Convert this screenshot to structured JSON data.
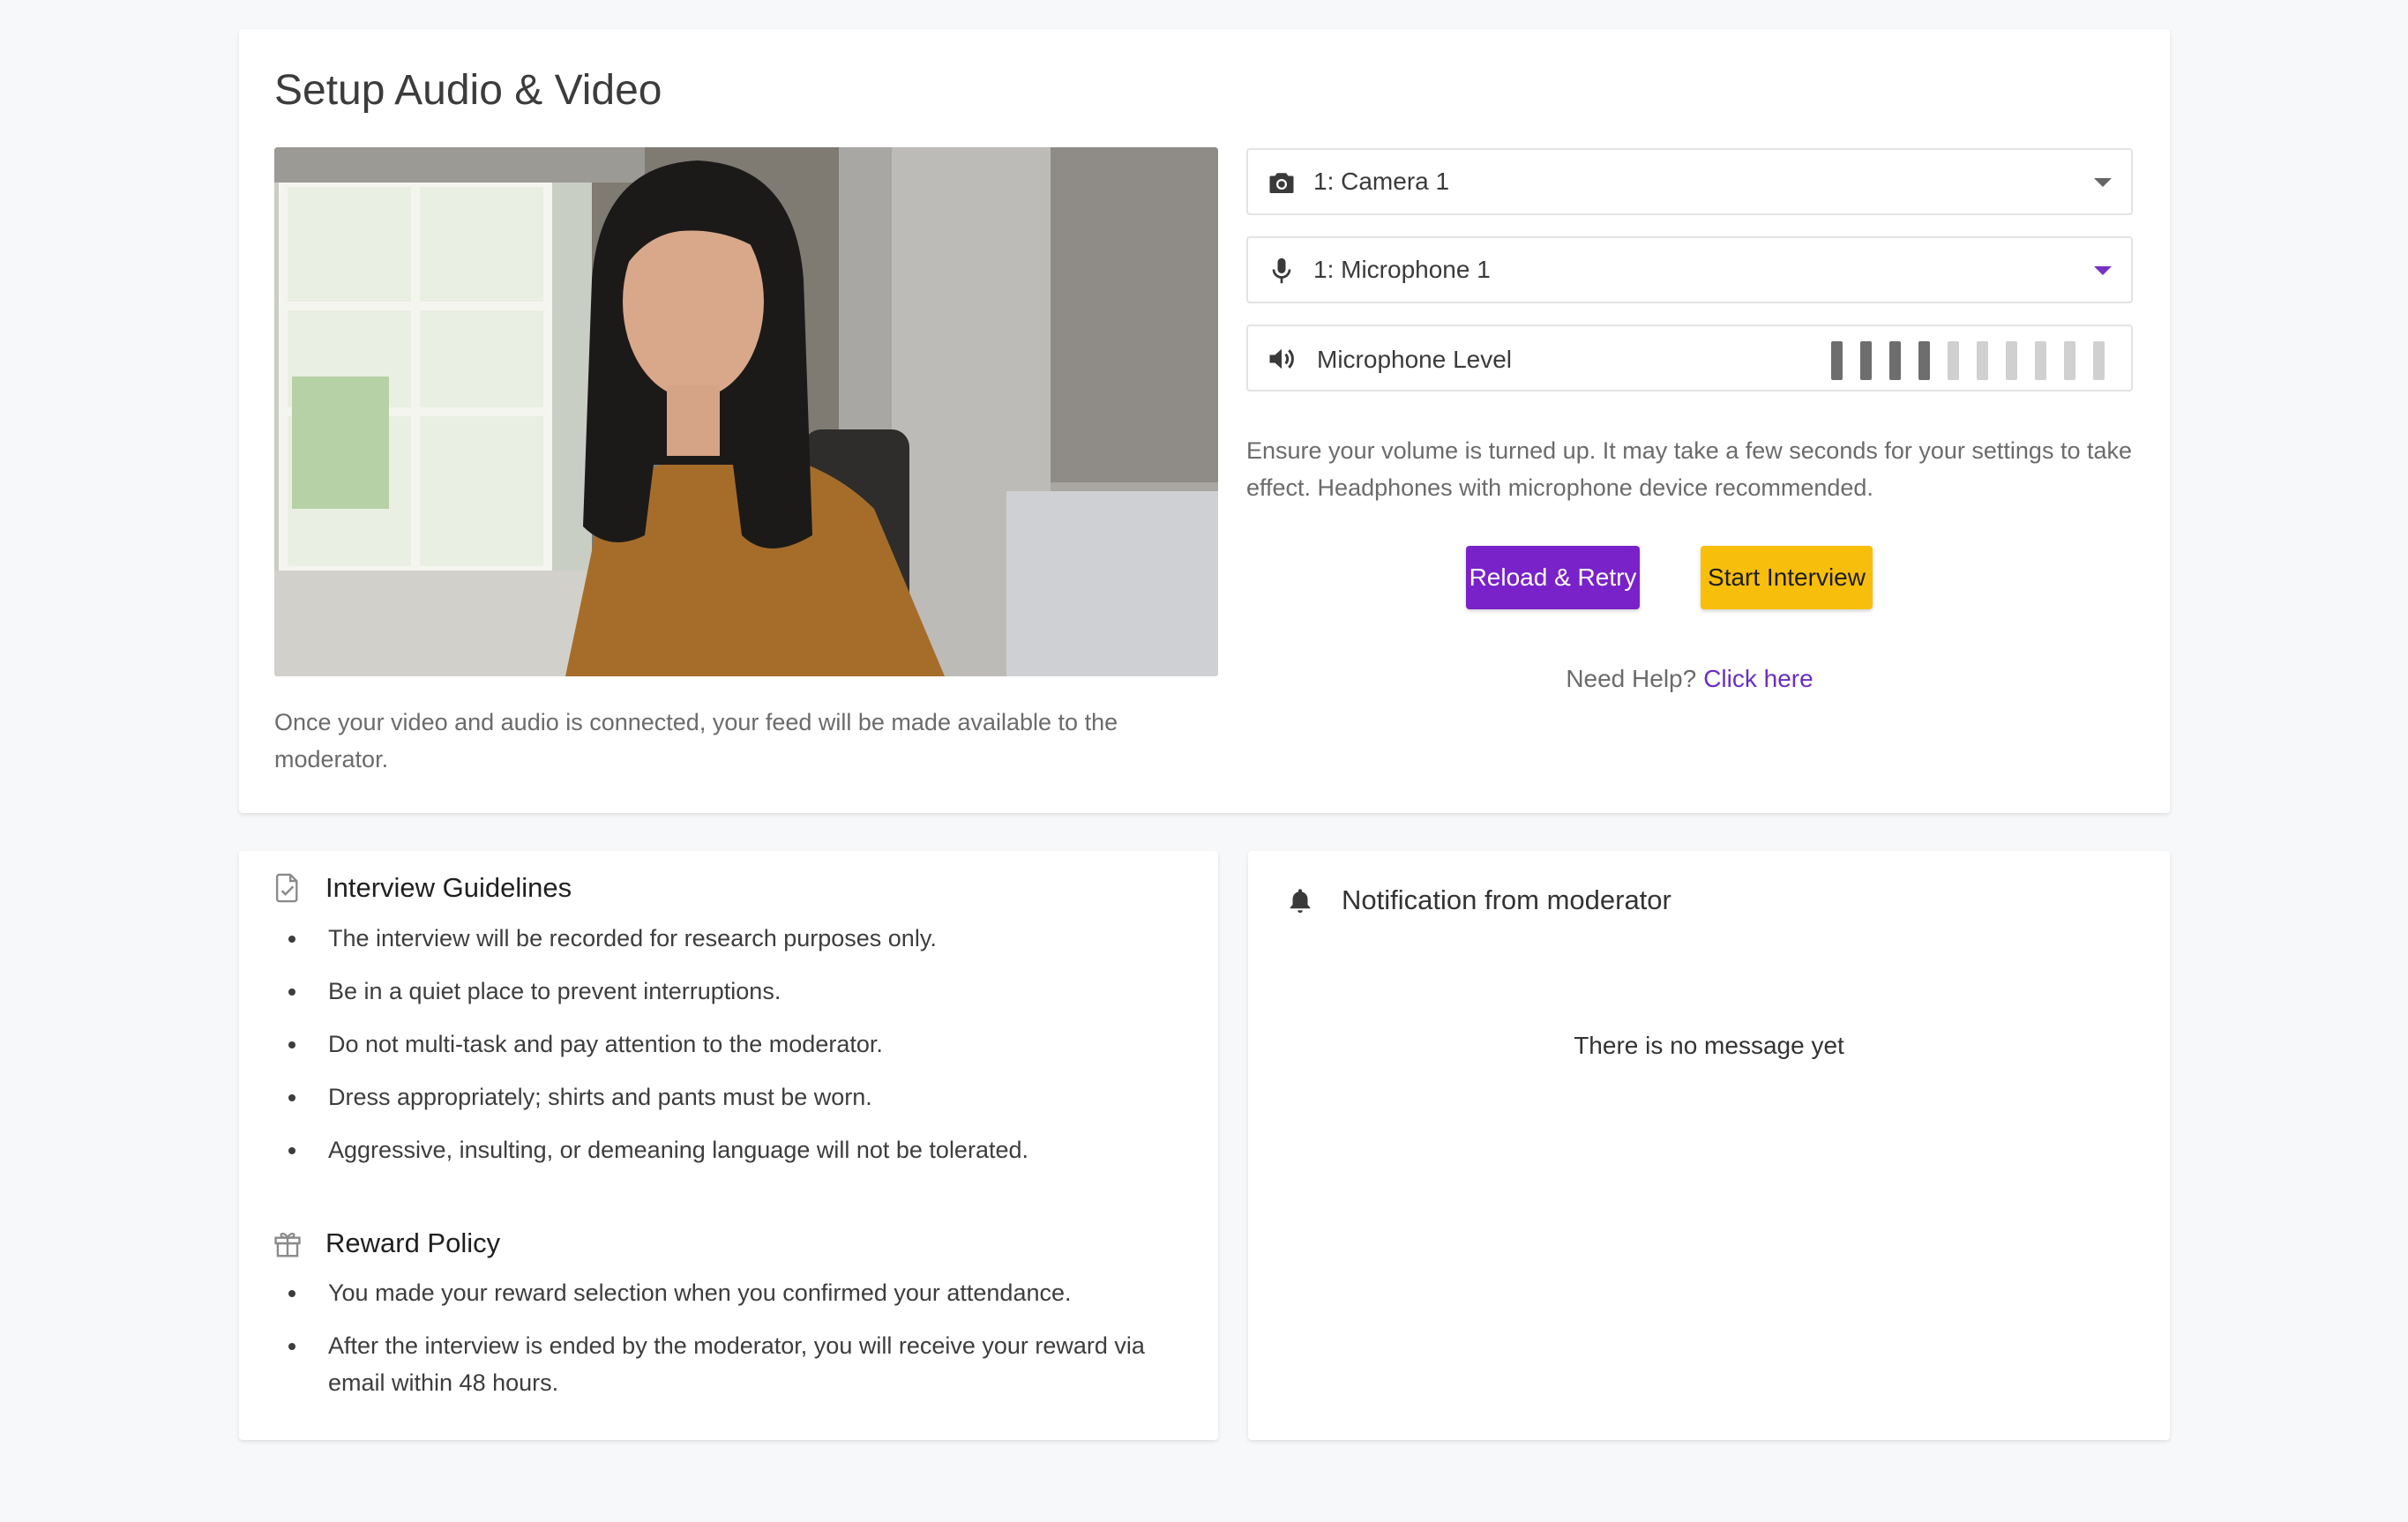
{
  "setup": {
    "title": "Setup Audio & Video",
    "video_caption": "Once your video and audio is connected, your feed will be made available to the moderator.",
    "camera": {
      "icon": "camera-icon",
      "selected": "1: Camera 1"
    },
    "microphone": {
      "icon": "microphone-icon",
      "selected": "1: Microphone 1"
    },
    "mic_level": {
      "icon": "speaker-icon",
      "label": "Microphone Level",
      "bars_total": 10,
      "bars_active": 4,
      "active_color": "#6e6e6e",
      "inactive_color": "#d0d0d0"
    },
    "help_text": "Ensure your volume is turned up. It may take a few seconds for your settings to take effect. Headphones with microphone device recommended.",
    "reload_label": "Reload & Retry",
    "start_label": "Start Interview",
    "need_help": "Need Help?",
    "click_here": "Click here"
  },
  "guidelines": {
    "icon": "document-check-icon",
    "title": "Interview Guidelines",
    "items": [
      "The interview will be recorded for research purposes only.",
      "Be in a quiet place to prevent interruptions.",
      "Do not multi-task and pay attention to the moderator.",
      "Dress appropriately; shirts and pants must be worn.",
      "Aggressive, insulting, or demeaning language will not be tolerated."
    ]
  },
  "reward": {
    "icon": "gift-icon",
    "title": "Reward Policy",
    "items": [
      "You made your reward selection when you confirmed your attendance.",
      "After the interview is ended by the moderator, you will receive your reward via email within 48 hours."
    ]
  },
  "notification": {
    "icon": "bell-icon",
    "title": "Notification from moderator",
    "empty_message": "There is no message yet"
  },
  "colors": {
    "primary": "#7a22c9",
    "accent": "#f7be0c",
    "link": "#6b2fc0"
  }
}
